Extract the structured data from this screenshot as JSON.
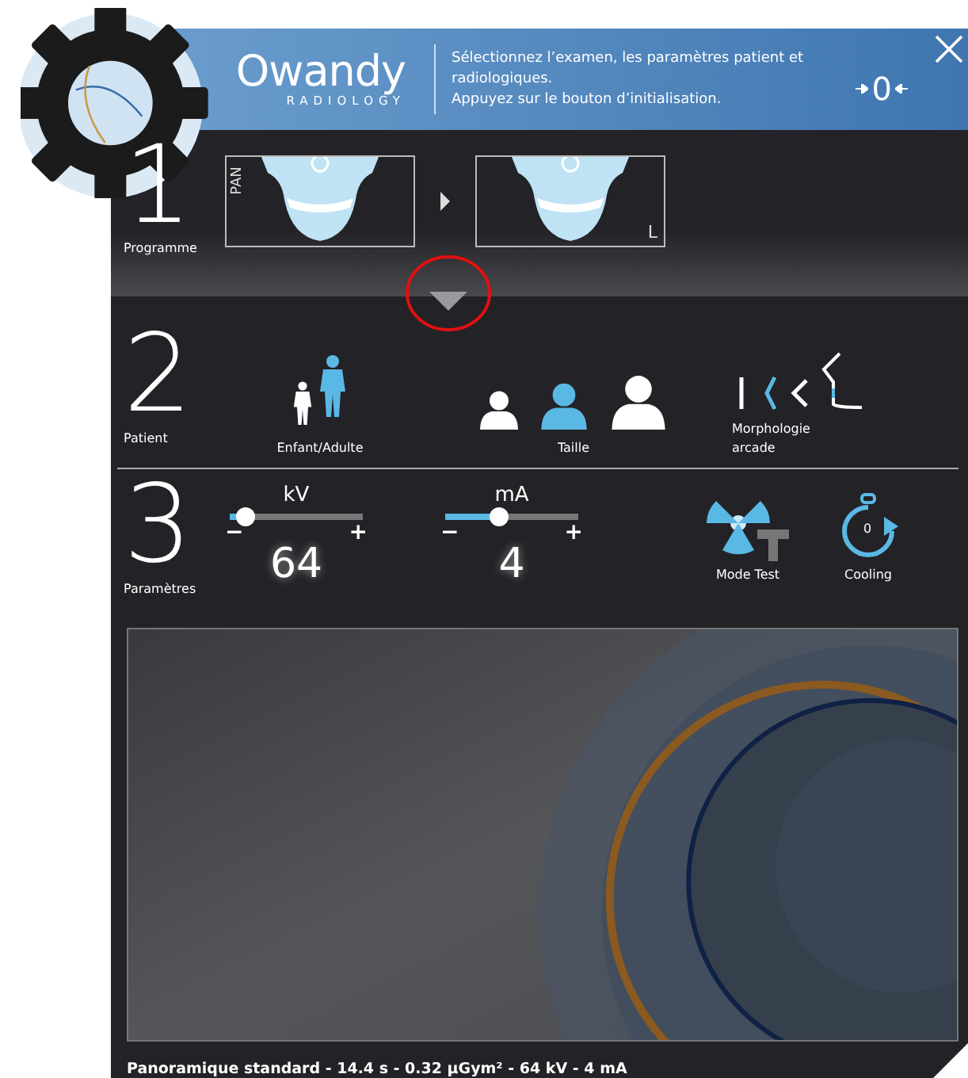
{
  "header": {
    "logo": "Owandy",
    "logo_sub": "RADIOLOGY",
    "instructions": [
      "Sélectionnez l’examen, les paramètres patient et",
      "radiologiques.",
      "Appuyez sur le bouton d’initialisation."
    ],
    "init_label": "0"
  },
  "programme": {
    "number": "1",
    "label": "Programme",
    "programs": [
      {
        "tag": "PAN",
        "kind": "panoramic"
      },
      {
        "tag": "L",
        "kind": "lateral"
      }
    ]
  },
  "patient": {
    "number": "2",
    "label": "Patient",
    "groups": [
      {
        "label": "Enfant/Adulte",
        "kind": "age",
        "options": [
          {
            "selected": false
          },
          {
            "selected": true
          }
        ]
      },
      {
        "label": "Taille",
        "kind": "size",
        "options": [
          {
            "selected": false
          },
          {
            "selected": true
          },
          {
            "selected": false
          }
        ]
      },
      {
        "label": "Morphologie arcade",
        "kind": "arch",
        "options": [
          {
            "selected": false
          },
          {
            "selected": true
          },
          {
            "selected": false
          }
        ]
      }
    ]
  },
  "parametres": {
    "number": "3",
    "label": "Paramètres",
    "sliders": [
      {
        "label": "kV",
        "value": "64",
        "minus": "−",
        "plus": "+",
        "level": 0.12
      },
      {
        "label": "mA",
        "value": "4",
        "minus": "−",
        "plus": "+",
        "level": 0.4
      }
    ],
    "tools": [
      {
        "label": "Mode Test",
        "kind": "test"
      },
      {
        "label": "Cooling",
        "kind": "cooling",
        "count": "0"
      }
    ]
  },
  "status": "Panoramique standard - 14.4 s - 0.32 µGym² - 64 kV - 4 mA"
}
